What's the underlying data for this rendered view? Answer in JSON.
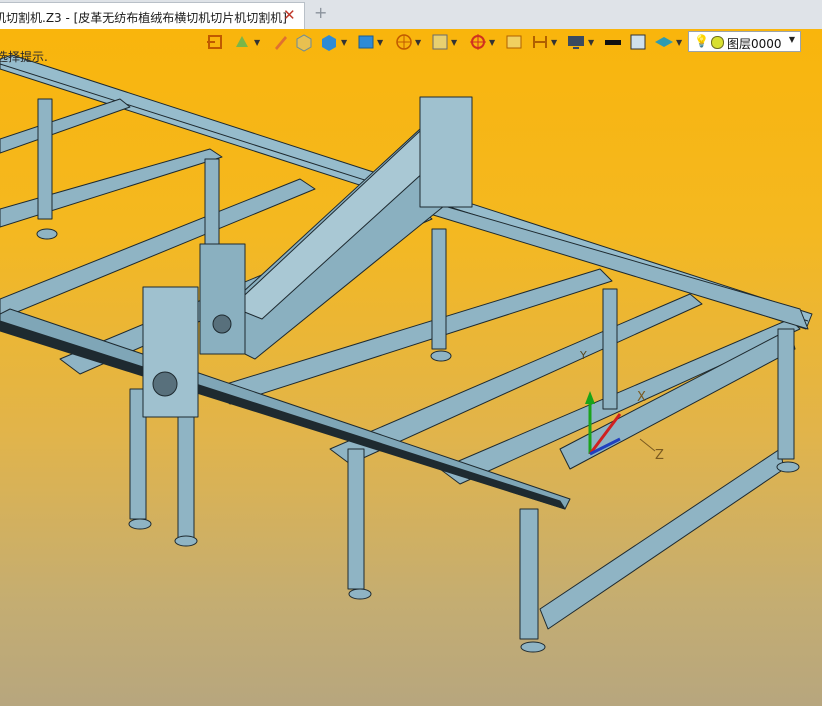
{
  "tab": {
    "title": "机切割机.Z3 - [皮革无纺布植绒布横切机切片机切割机]",
    "close_icon": "close-icon",
    "new_tab_icon": "plus-icon"
  },
  "viewport": {
    "hint": "选择提示.",
    "layer_selector": {
      "value": "图层0000"
    },
    "axes": {
      "x": "X",
      "y": "Y",
      "z": "Z"
    }
  },
  "toolbar_icons": [
    "export-icon",
    "paint-icon",
    "pencil-icon",
    "cube-shaded-icon",
    "cube-blue-icon",
    "view-cube-icon",
    "sphere-wire-icon",
    "box-wire-icon",
    "target-icon",
    "frame-icon",
    "dimension-icon",
    "monitor-icon",
    "line-black-icon",
    "fill-icon",
    "layer-stack-icon",
    "bulb-icon",
    "layer-color-icon"
  ],
  "colors": {
    "background_top": "#f9b50c",
    "background_bottom": "#b7a67e",
    "frame": "#8fb4c4",
    "frame_dark": "#1e2a30"
  }
}
